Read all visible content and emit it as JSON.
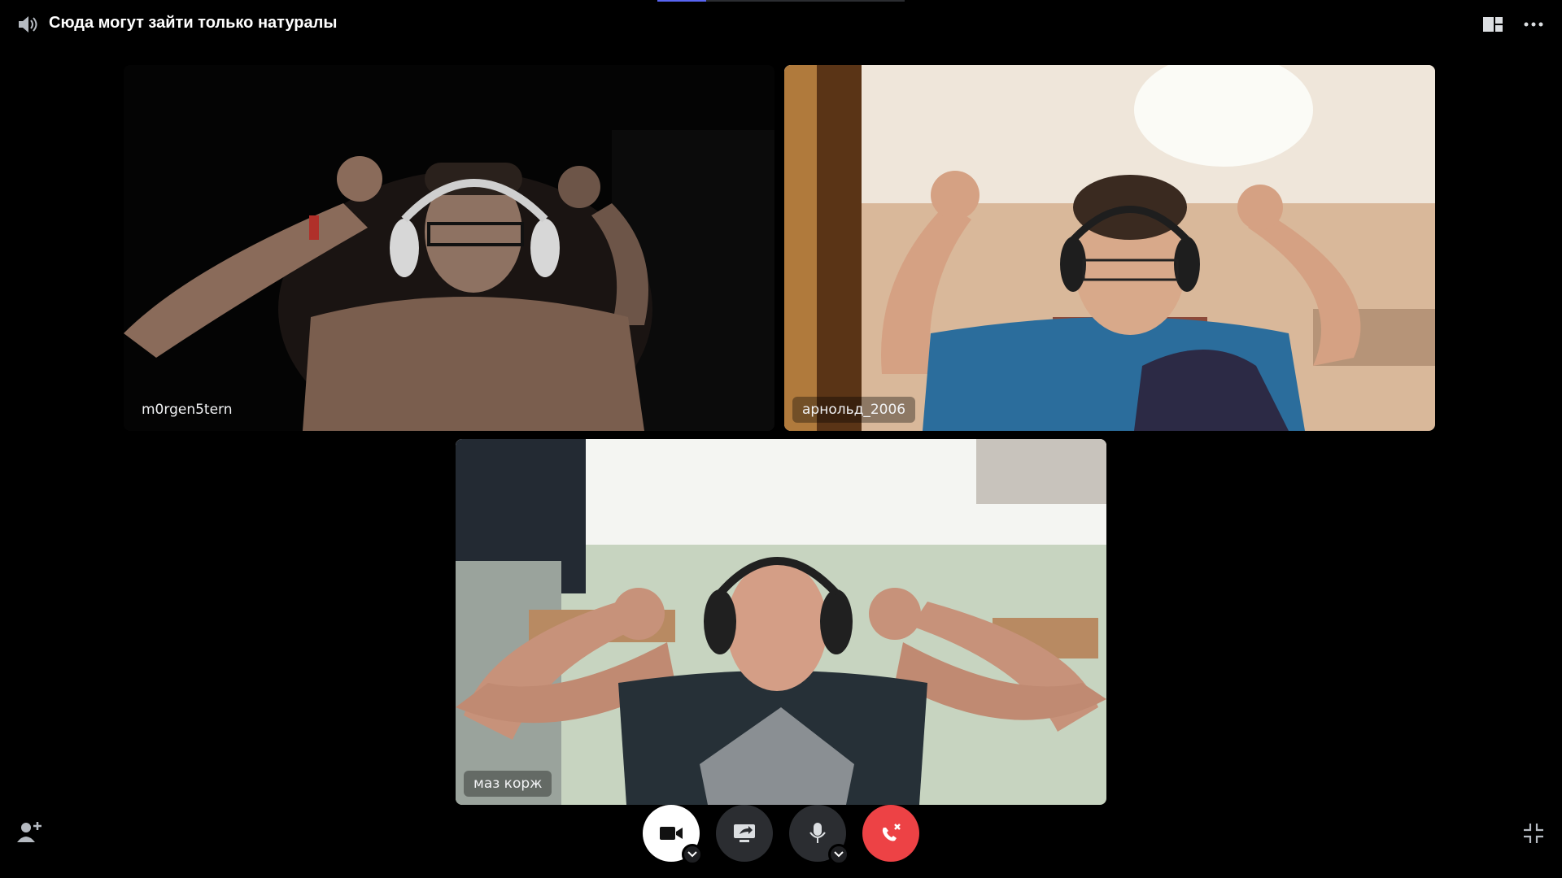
{
  "header": {
    "channel_title": "Сюда могут зайти только натуралы",
    "channel_icon": "voice-channel-icon",
    "layout_icon": "grid-layout-icon",
    "more_icon": "more-options-icon"
  },
  "participants": [
    {
      "name": "m0rgen5tern",
      "camera_on": true
    },
    {
      "name": "арнольд_2006",
      "camera_on": true
    },
    {
      "name": "маз корж",
      "camera_on": true
    }
  ],
  "controls": {
    "add_user_icon": "add-user-icon",
    "camera_icon": "camera-icon",
    "screen_share_icon": "screen-share-icon",
    "mic_icon": "microphone-icon",
    "leave_icon": "disconnect-call-icon",
    "fullscreen_icon": "exit-fullscreen-icon"
  },
  "colors": {
    "background": "#000000",
    "accent": "#5865f2",
    "danger": "#ed4245",
    "control_dark": "#2b2d31"
  }
}
